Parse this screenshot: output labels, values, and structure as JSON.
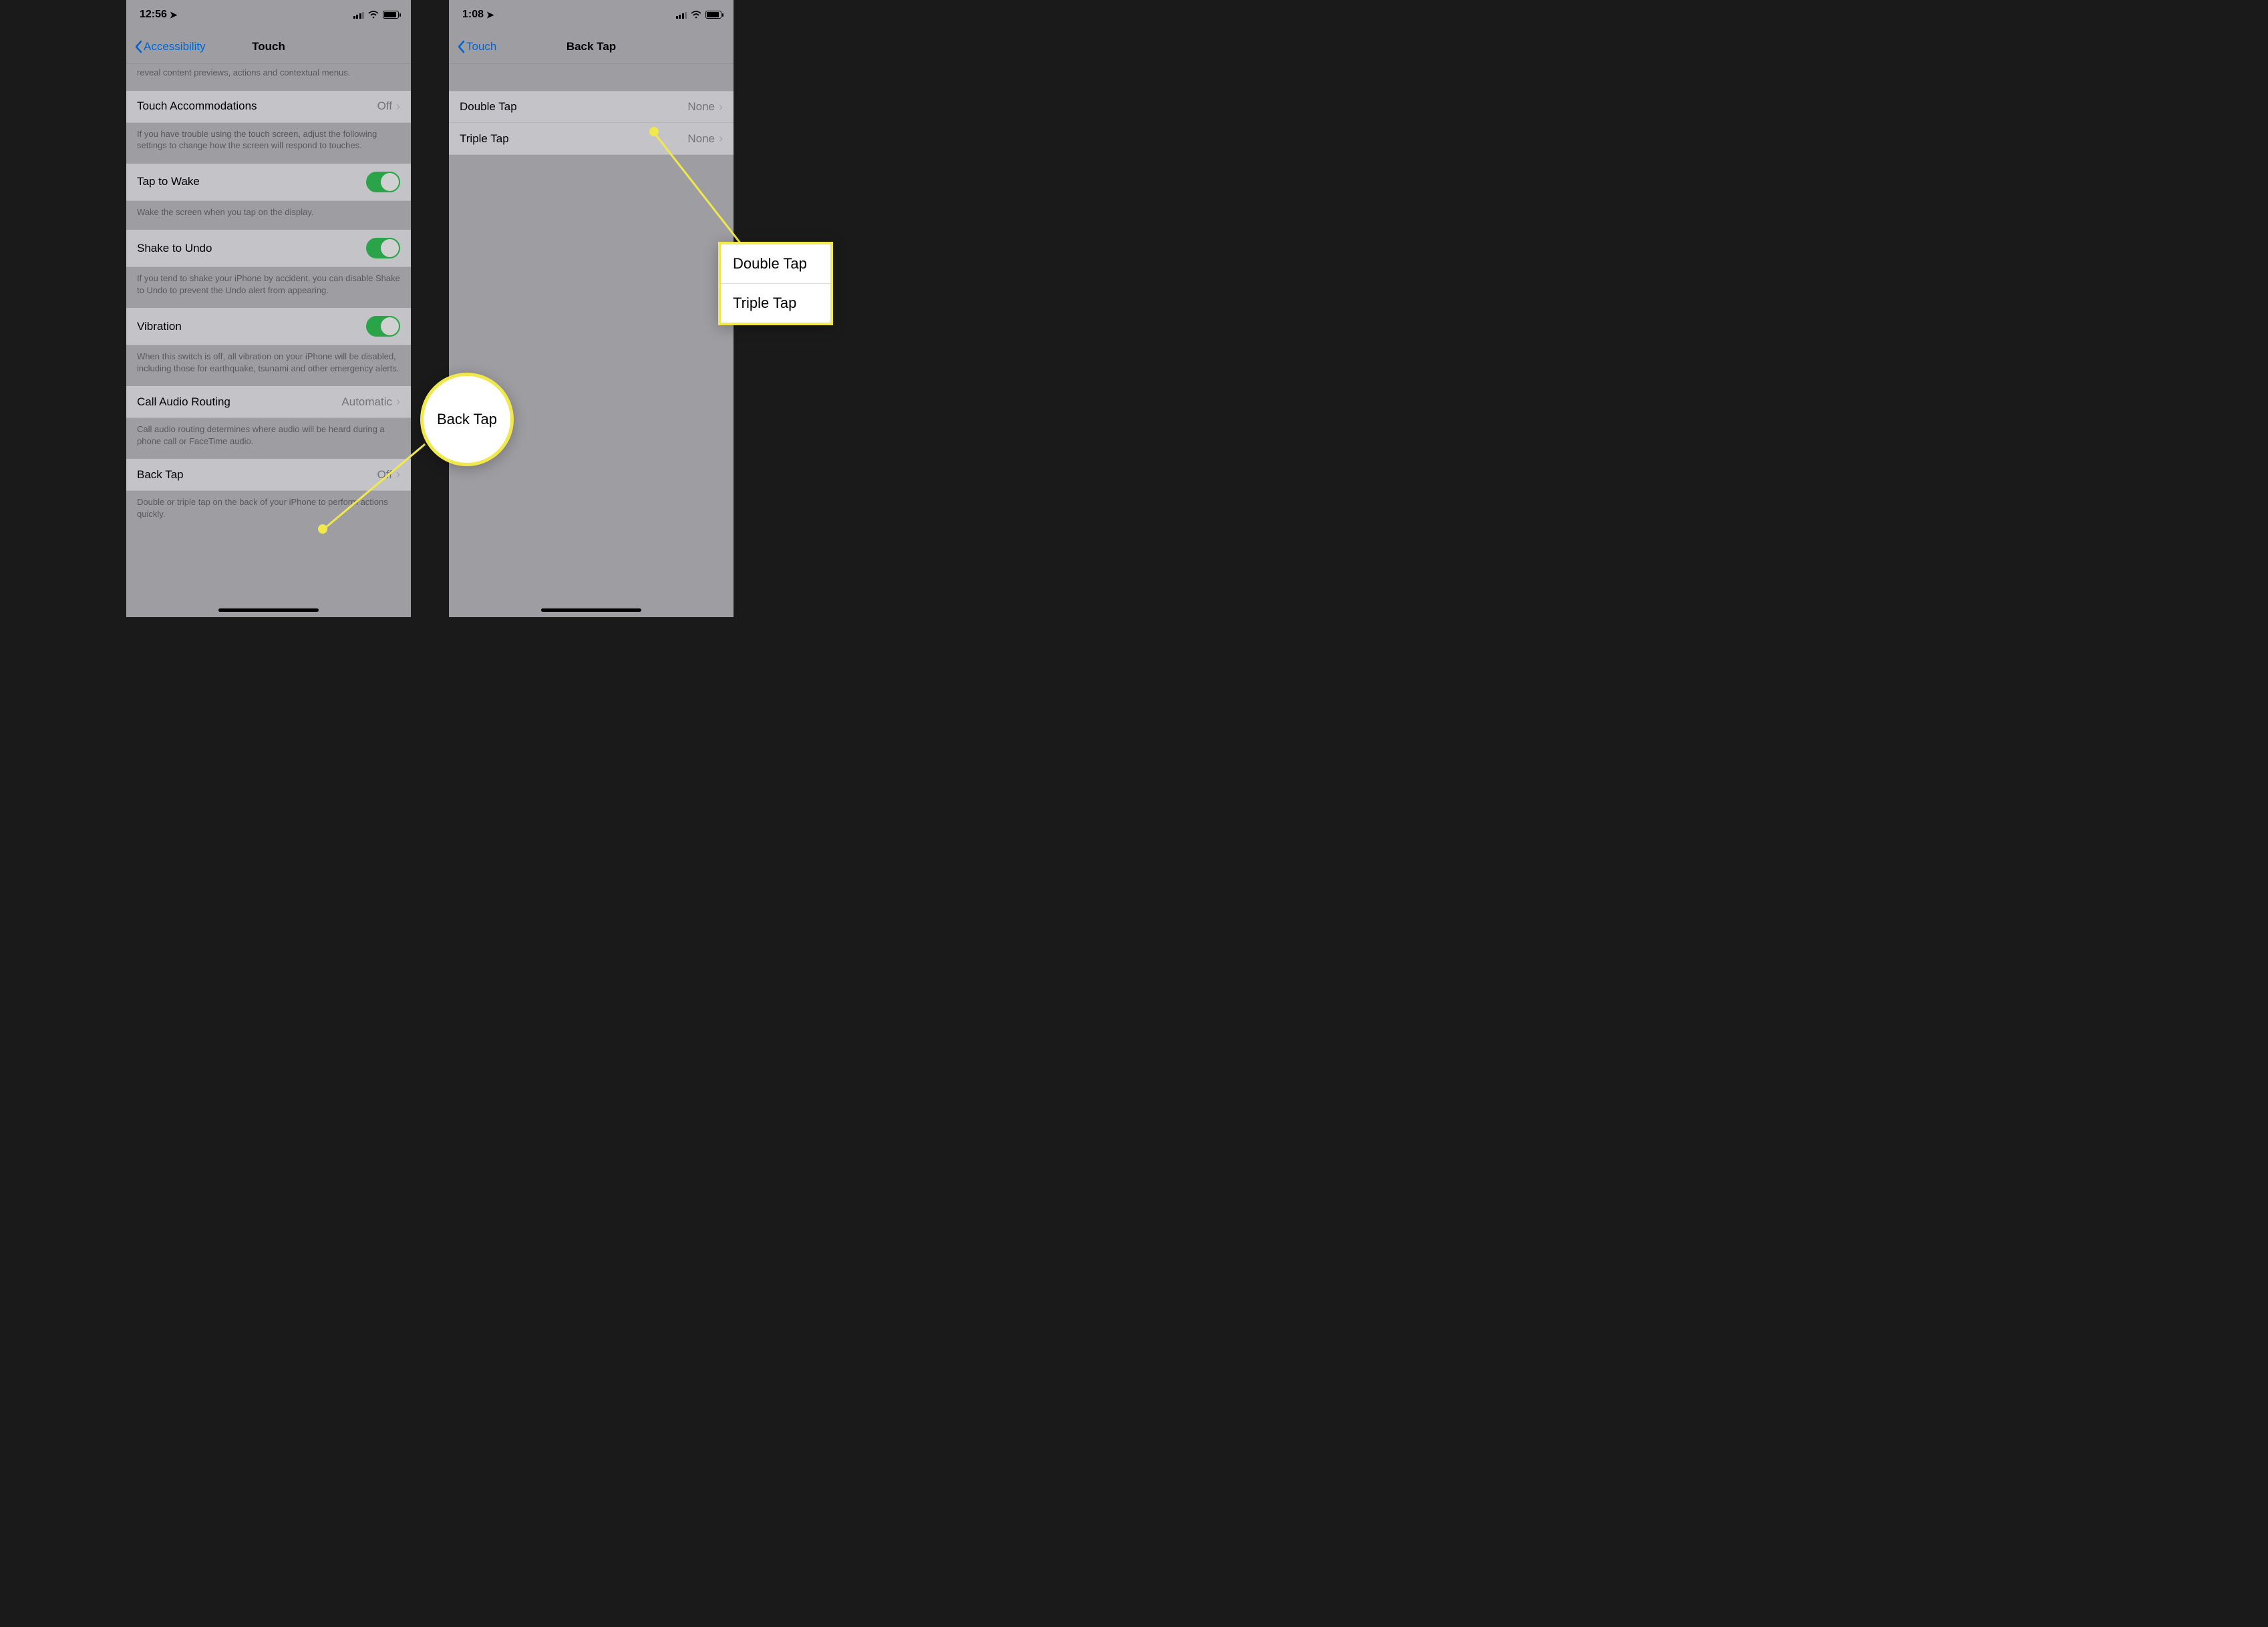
{
  "left": {
    "time": "12:56",
    "back_label": "Accessibility",
    "title": "Touch",
    "intro_footer": "reveal content previews, actions and contextual menus.",
    "touch_accommodations": {
      "label": "Touch Accommodations",
      "value": "Off"
    },
    "touch_accommodations_footer": "If you have trouble using the touch screen, adjust the following settings to change how the screen will respond to touches.",
    "tap_to_wake": {
      "label": "Tap to Wake"
    },
    "tap_to_wake_footer": "Wake the screen when you tap on the display.",
    "shake_to_undo": {
      "label": "Shake to Undo"
    },
    "shake_to_undo_footer": "If you tend to shake your iPhone by accident, you can disable Shake to Undo to prevent the Undo alert from appearing.",
    "vibration": {
      "label": "Vibration"
    },
    "vibration_footer": "When this switch is off, all vibration on your iPhone will be disabled, including those for earthquake, tsunami and other emergency alerts.",
    "call_audio": {
      "label": "Call Audio Routing",
      "value": "Automatic"
    },
    "call_audio_footer": "Call audio routing determines where audio will be heard during a phone call or FaceTime audio.",
    "back_tap": {
      "label": "Back Tap",
      "value": "Off"
    },
    "back_tap_footer": "Double or triple tap on the back of your iPhone to perform actions quickly.",
    "callout_label": "Back Tap"
  },
  "right": {
    "time": "1:08",
    "back_label": "Touch",
    "title": "Back Tap",
    "double_tap": {
      "label": "Double Tap",
      "value": "None"
    },
    "triple_tap": {
      "label": "Triple Tap",
      "value": "None"
    },
    "callout_top": "Double Tap",
    "callout_bottom": "Triple Tap"
  }
}
